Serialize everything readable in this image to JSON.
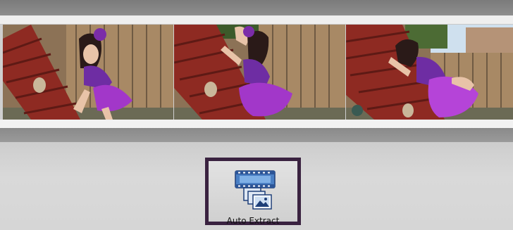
{
  "timeline": {
    "frames": [
      {
        "name": "video-frame-1"
      },
      {
        "name": "video-frame-2"
      },
      {
        "name": "video-frame-3"
      }
    ]
  },
  "toolbar": {
    "auto_extract": {
      "label": "Auto Extract",
      "icon": "film-extract-icon"
    }
  },
  "colors": {
    "button_border": "#3a2240",
    "panel_bg": "#d4d4d4",
    "icon_blue": "#4a7fc4"
  }
}
